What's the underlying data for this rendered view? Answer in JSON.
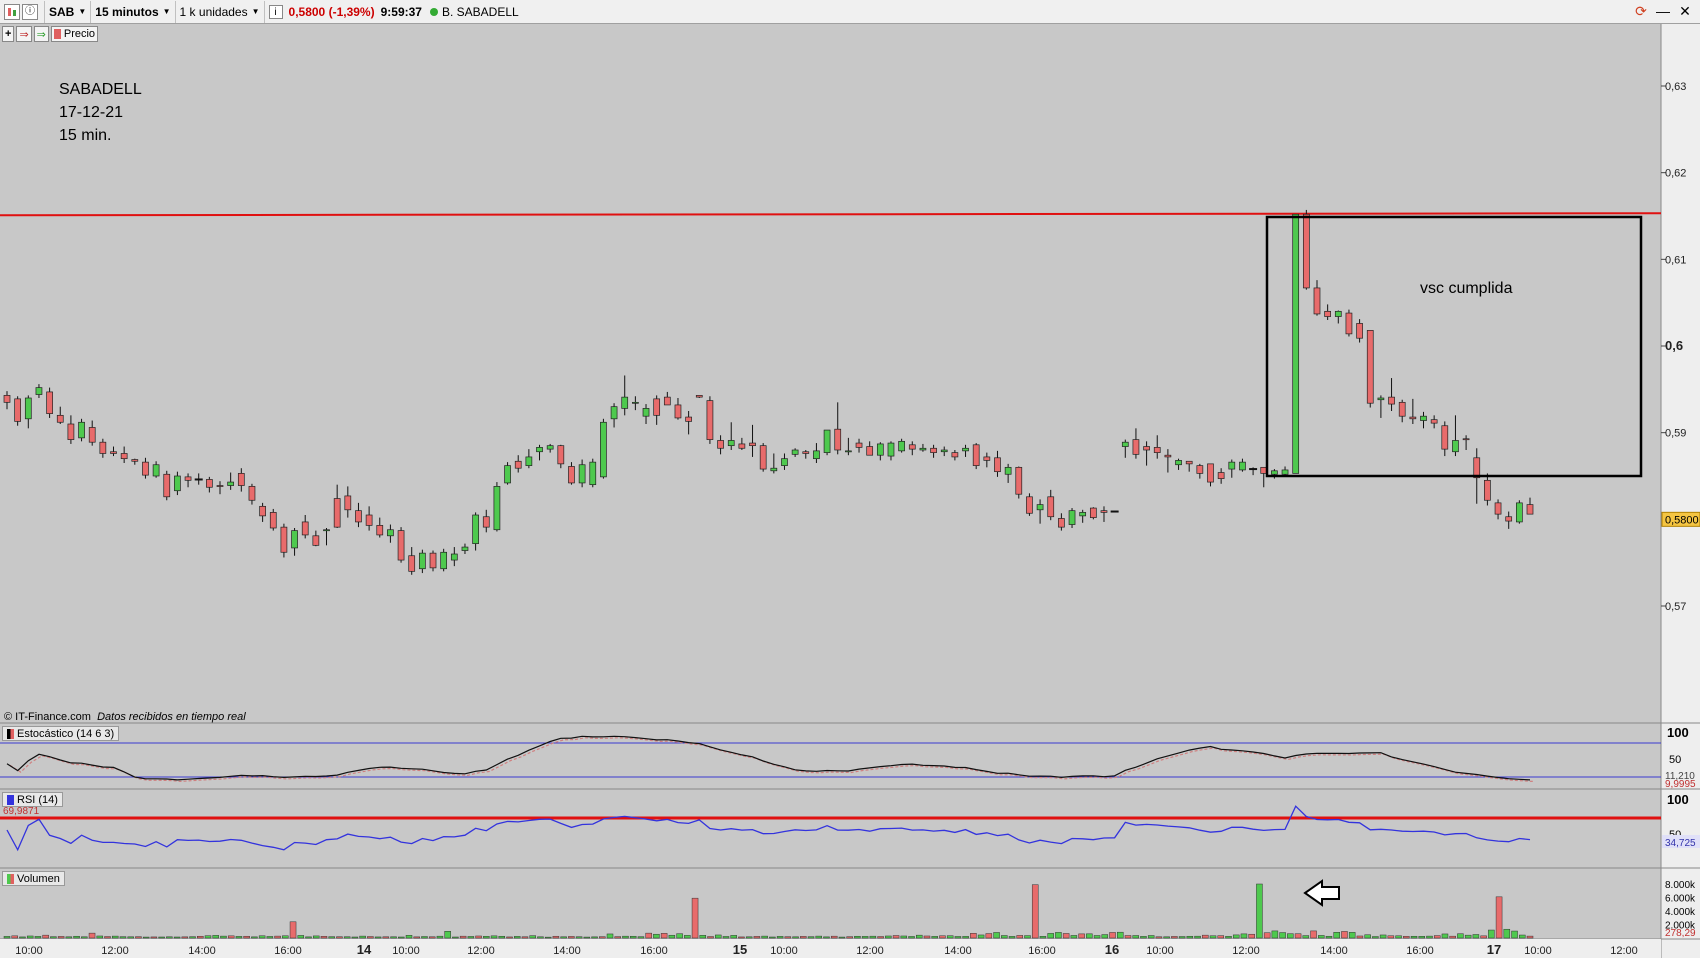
{
  "toolbar": {
    "symbol": "SAB",
    "interval": "15 minutos",
    "units": "1 k unidades",
    "price": "0,5800",
    "change": "(-1,39%)",
    "time": "9:59:37",
    "company": "B. SABADELL"
  },
  "subbar": {
    "price_label": "Precio"
  },
  "annotations": {
    "line1": "SABADELL",
    "line2": "17-12-21",
    "line3": "15 min.",
    "box_note": "vsc cumplida"
  },
  "credits": {
    "source": "© IT-Finance.com",
    "note": "Datos recibidos en tiempo real"
  },
  "indicators": {
    "stoch_label": "Estocástico (14 6 3)",
    "rsi_label": "RSI (14)",
    "vol_label": "Volumen",
    "rsi_line_value": "69,9871",
    "stoch_val1": "11,210",
    "stoch_val2": "9,9995",
    "rsi_current": "34,725",
    "vol_current": "278,29"
  },
  "colors": {
    "up": "#4ec94e",
    "down": "#e86b6b",
    "resistance": "#e01010",
    "stoch_band": "#3a3ad0",
    "rsi": "#3333dd"
  },
  "chart_data": {
    "type": "candlestick",
    "price_axis_ticks": [
      "0,63",
      "0,62",
      "0,61",
      "0,6",
      "0,59",
      "0,57"
    ],
    "current_price_label": "0,5800",
    "stoch_axis_ticks": [
      "100",
      "50"
    ],
    "rsi_axis_ticks": [
      "100",
      "50"
    ],
    "volume_axis_ticks": [
      "8.000k",
      "6.000k",
      "4.000k",
      "2.000k"
    ],
    "time_labels": [
      "10:00",
      "12:00",
      "14:00",
      "16:00",
      "14",
      "10:00",
      "12:00",
      "14:00",
      "16:00",
      "15",
      "10:00",
      "12:00",
      "14:00",
      "16:00",
      "16",
      "10:00",
      "12:00",
      "14:00",
      "16:00",
      "17",
      "10:00",
      "12:00"
    ],
    "resistance_level": 0.6152,
    "ylim": [
      0.564,
      0.635
    ],
    "candles": [
      [
        0.5943,
        0.5948,
        0.5927,
        0.5935
      ],
      [
        0.5939,
        0.5942,
        0.5908,
        0.5913
      ],
      [
        0.5916,
        0.5943,
        0.5905,
        0.594
      ],
      [
        0.5944,
        0.5956,
        0.594,
        0.5952
      ],
      [
        0.5947,
        0.5952,
        0.5917,
        0.5922
      ],
      [
        0.592,
        0.593,
        0.591,
        0.5912
      ],
      [
        0.591,
        0.592,
        0.5887,
        0.5892
      ],
      [
        0.5894,
        0.5916,
        0.589,
        0.5912
      ],
      [
        0.5906,
        0.5914,
        0.5885,
        0.5889
      ],
      [
        0.5889,
        0.5893,
        0.5871,
        0.5876
      ],
      [
        0.5878,
        0.5884,
        0.5873,
        0.5876
      ],
      [
        0.5876,
        0.5884,
        0.5865,
        0.587
      ],
      [
        0.5869,
        0.587,
        0.5863,
        0.5867
      ],
      [
        0.5866,
        0.5871,
        0.5847,
        0.5851
      ],
      [
        0.585,
        0.5867,
        0.5848,
        0.5863
      ],
      [
        0.5852,
        0.5856,
        0.5822,
        0.5826
      ],
      [
        0.5833,
        0.5855,
        0.5828,
        0.585
      ],
      [
        0.5849,
        0.5853,
        0.5837,
        0.5845
      ],
      [
        0.5846,
        0.5853,
        0.584,
        0.5846
      ],
      [
        0.5846,
        0.5849,
        0.5831,
        0.5837
      ],
      [
        0.5839,
        0.5844,
        0.5829,
        0.5838
      ],
      [
        0.5839,
        0.5854,
        0.5834,
        0.5843
      ],
      [
        0.5853,
        0.5859,
        0.5832,
        0.5839
      ],
      [
        0.5838,
        0.5841,
        0.5817,
        0.5822
      ],
      [
        0.5815,
        0.5819,
        0.5797,
        0.5804
      ],
      [
        0.5808,
        0.5812,
        0.5787,
        0.579
      ],
      [
        0.5791,
        0.5795,
        0.5756,
        0.5762
      ],
      [
        0.5767,
        0.579,
        0.5758,
        0.5787
      ],
      [
        0.5797,
        0.5805,
        0.5778,
        0.5782
      ],
      [
        0.5781,
        0.5787,
        0.5769,
        0.577
      ],
      [
        0.5787,
        0.579,
        0.577,
        0.5788
      ],
      [
        0.5824,
        0.584,
        0.579,
        0.5791
      ],
      [
        0.5827,
        0.5838,
        0.5802,
        0.5811
      ],
      [
        0.581,
        0.5819,
        0.5791,
        0.5797
      ],
      [
        0.5805,
        0.5815,
        0.5787,
        0.5793
      ],
      [
        0.5793,
        0.5802,
        0.5779,
        0.5782
      ],
      [
        0.5781,
        0.5794,
        0.5773,
        0.5788
      ],
      [
        0.5787,
        0.5791,
        0.575,
        0.5753
      ],
      [
        0.5758,
        0.5768,
        0.5736,
        0.574
      ],
      [
        0.5743,
        0.5765,
        0.5738,
        0.5761
      ],
      [
        0.5761,
        0.5764,
        0.574,
        0.5744
      ],
      [
        0.5743,
        0.5766,
        0.574,
        0.5762
      ],
      [
        0.5753,
        0.5768,
        0.5746,
        0.576
      ],
      [
        0.5764,
        0.5772,
        0.576,
        0.5768
      ],
      [
        0.5772,
        0.5808,
        0.5764,
        0.5805
      ],
      [
        0.5803,
        0.5811,
        0.5785,
        0.5791
      ],
      [
        0.5788,
        0.5843,
        0.5786,
        0.5838
      ],
      [
        0.5842,
        0.5866,
        0.584,
        0.5862
      ],
      [
        0.5867,
        0.5874,
        0.5854,
        0.5859
      ],
      [
        0.5862,
        0.5881,
        0.5859,
        0.5872
      ],
      [
        0.5878,
        0.5886,
        0.5868,
        0.5883
      ],
      [
        0.5881,
        0.5887,
        0.5877,
        0.5885
      ],
      [
        0.5885,
        0.5886,
        0.5859,
        0.5864
      ],
      [
        0.5861,
        0.5866,
        0.584,
        0.5842
      ],
      [
        0.5842,
        0.5869,
        0.5837,
        0.5863
      ],
      [
        0.584,
        0.587,
        0.5837,
        0.5866
      ],
      [
        0.5849,
        0.5916,
        0.5847,
        0.5912
      ],
      [
        0.5916,
        0.5934,
        0.5906,
        0.593
      ],
      [
        0.5928,
        0.5966,
        0.592,
        0.5941
      ],
      [
        0.5934,
        0.5942,
        0.5926,
        0.5935
      ],
      [
        0.5919,
        0.5933,
        0.591,
        0.5928
      ],
      [
        0.5939,
        0.5943,
        0.5909,
        0.592
      ],
      [
        0.5941,
        0.5947,
        0.5938,
        0.5932
      ],
      [
        0.5932,
        0.594,
        0.5915,
        0.5917
      ],
      [
        0.5918,
        0.5925,
        0.5898,
        0.5913
      ],
      [
        0.5943,
        0.5943,
        0.594,
        0.5941
      ],
      [
        0.5937,
        0.5942,
        0.5887,
        0.5892
      ],
      [
        0.5891,
        0.5897,
        0.5875,
        0.5882
      ],
      [
        0.5885,
        0.5912,
        0.588,
        0.5891
      ],
      [
        0.5887,
        0.5894,
        0.588,
        0.5882
      ],
      [
        0.5888,
        0.5909,
        0.5872,
        0.5885
      ],
      [
        0.5885,
        0.5888,
        0.5855,
        0.5858
      ],
      [
        0.5856,
        0.5876,
        0.5853,
        0.5859
      ],
      [
        0.5862,
        0.5876,
        0.5857,
        0.587
      ],
      [
        0.5875,
        0.5882,
        0.5872,
        0.588
      ],
      [
        0.5878,
        0.588,
        0.587,
        0.5876
      ],
      [
        0.587,
        0.5888,
        0.5865,
        0.5879
      ],
      [
        0.5877,
        0.5901,
        0.5874,
        0.5903
      ],
      [
        0.5904,
        0.5935,
        0.5875,
        0.588
      ],
      [
        0.5878,
        0.5894,
        0.5874,
        0.5879
      ],
      [
        0.5888,
        0.5893,
        0.5877,
        0.5883
      ],
      [
        0.5884,
        0.589,
        0.588,
        0.5874
      ],
      [
        0.5874,
        0.5889,
        0.5868,
        0.5887
      ],
      [
        0.5873,
        0.589,
        0.5868,
        0.5888
      ],
      [
        0.5879,
        0.5893,
        0.5877,
        0.589
      ],
      [
        0.5886,
        0.589,
        0.5874,
        0.5881
      ],
      [
        0.588,
        0.5887,
        0.5878,
        0.5882
      ],
      [
        0.5882,
        0.5886,
        0.5871,
        0.5877
      ],
      [
        0.5878,
        0.5884,
        0.5873,
        0.588
      ],
      [
        0.5877,
        0.588,
        0.5868,
        0.5872
      ],
      [
        0.5879,
        0.5886,
        0.5872,
        0.5882
      ],
      [
        0.5886,
        0.5888,
        0.5858,
        0.5862
      ],
      [
        0.5872,
        0.5877,
        0.586,
        0.5868
      ],
      [
        0.5871,
        0.5879,
        0.5849,
        0.5855
      ],
      [
        0.5852,
        0.5864,
        0.5842,
        0.586
      ],
      [
        0.586,
        0.5861,
        0.5824,
        0.5829
      ],
      [
        0.5826,
        0.583,
        0.5804,
        0.5807
      ],
      [
        0.5811,
        0.5823,
        0.5795,
        0.5817
      ],
      [
        0.5826,
        0.5834,
        0.5799,
        0.5803
      ],
      [
        0.5801,
        0.5807,
        0.5787,
        0.5791
      ],
      [
        0.5794,
        0.5813,
        0.579,
        0.581
      ],
      [
        0.5804,
        0.5811,
        0.5796,
        0.5808
      ],
      [
        0.5813,
        0.5814,
        0.58,
        0.5802
      ],
      [
        0.581,
        0.5815,
        0.5797,
        0.5808
      ],
      [
        0.5809,
        0.5809,
        0.5809,
        0.5809
      ],
      [
        0.5884,
        0.5892,
        0.5871,
        0.5889
      ],
      [
        0.5892,
        0.5905,
        0.587,
        0.5875
      ],
      [
        0.5884,
        0.589,
        0.5862,
        0.588
      ],
      [
        0.5883,
        0.5897,
        0.587,
        0.5877
      ],
      [
        0.5874,
        0.5881,
        0.5854,
        0.5872
      ],
      [
        0.5863,
        0.587,
        0.5857,
        0.5868
      ],
      [
        0.5867,
        0.5866,
        0.5855,
        0.5864
      ],
      [
        0.5862,
        0.5864,
        0.5847,
        0.5853
      ],
      [
        0.5864,
        0.5861,
        0.5838,
        0.5843
      ],
      [
        0.5854,
        0.5859,
        0.5841,
        0.5847
      ],
      [
        0.5858,
        0.5869,
        0.5848,
        0.5866
      ],
      [
        0.5857,
        0.587,
        0.5855,
        0.5866
      ],
      [
        0.5858,
        0.586,
        0.5851,
        0.5858
      ],
      [
        0.586,
        0.5859,
        0.5837,
        0.5853
      ],
      [
        0.5852,
        0.5858,
        0.5847,
        0.5856
      ],
      [
        0.5852,
        0.5861,
        0.5849,
        0.5857
      ],
      [
        0.5853,
        0.6152,
        0.5855,
        0.6152
      ],
      [
        0.6152,
        0.6157,
        0.6065,
        0.6067
      ],
      [
        0.6067,
        0.6076,
        0.6035,
        0.6037
      ],
      [
        0.604,
        0.6048,
        0.603,
        0.6034
      ],
      [
        0.6034,
        0.6041,
        0.6026,
        0.604
      ],
      [
        0.6038,
        0.6042,
        0.6011,
        0.6014
      ],
      [
        0.6026,
        0.6031,
        0.6004,
        0.6009
      ],
      [
        0.6018,
        0.6018,
        0.5929,
        0.5934
      ],
      [
        0.5938,
        0.5943,
        0.5917,
        0.594
      ],
      [
        0.5941,
        0.5963,
        0.5925,
        0.5933
      ],
      [
        0.5935,
        0.5938,
        0.5912,
        0.5919
      ],
      [
        0.5918,
        0.5939,
        0.591,
        0.5916
      ],
      [
        0.5914,
        0.5924,
        0.5905,
        0.5919
      ],
      [
        0.5915,
        0.592,
        0.5905,
        0.5911
      ],
      [
        0.5908,
        0.5913,
        0.5873,
        0.5881
      ],
      [
        0.5878,
        0.592,
        0.5873,
        0.5891
      ],
      [
        0.5893,
        0.5897,
        0.588,
        0.5892
      ],
      [
        0.5871,
        0.5882,
        0.5818,
        0.5848
      ],
      [
        0.5845,
        0.5853,
        0.5816,
        0.5822
      ],
      [
        0.5819,
        0.5823,
        0.58,
        0.5806
      ],
      [
        0.5803,
        0.5809,
        0.5789,
        0.5798
      ],
      [
        0.5797,
        0.5822,
        0.5795,
        0.5819
      ],
      [
        0.5817,
        0.5825,
        0.5809,
        0.5806
      ]
    ],
    "volumes_k": [
      240,
      320,
      160,
      300,
      240,
      420,
      200,
      230,
      180,
      260,
      180,
      720,
      300,
      220,
      280,
      200,
      180,
      200,
      140,
      160,
      150,
      180,
      150,
      170,
      200,
      260,
      340,
      390,
      280,
      320,
      240,
      260,
      170,
      330,
      230,
      280,
      330,
      2400,
      380,
      170,
      310,
      250,
      200,
      190,
      190,
      150,
      280,
      220,
      160,
      180,
      180,
      150,
      400,
      170,
      220,
      180,
      270,
      1000,
      150,
      270,
      230,
      300,
      250,
      320,
      260,
      160,
      240,
      180,
      350,
      180,
      130,
      260,
      180,
      230,
      190,
      140,
      170,
      200,
      600,
      210,
      270,
      260,
      200,
      720,
      560,
      690,
      410,
      640,
      390,
      5900,
      400,
      220,
      450,
      230,
      390,
      160,
      180,
      240,
      280,
      150,
      240,
      200,
      180,
      240,
      200,
      280,
      170,
      270,
      140,
      200,
      260,
      240,
      270,
      220,
      300,
      370,
      300,
      230,
      420,
      300,
      240,
      330,
      340,
      230,
      240,
      700,
      450,
      660,
      820,
      370,
      240,
      380,
      360,
      7900,
      250,
      680,
      830,
      670,
      380,
      610,
      620,
      370,
      510,
      820,
      860,
      370,
      370,
      240,
      370,
      180,
      180,
      230,
      220,
      260,
      270,
      420,
      330,
      350,
      250,
      460,
      610,
      560,
      8000,
      780,
      1050,
      810,
      640,
      630,
      360,
      1050,
      380,
      260,
      850,
      970,
      840,
      300,
      480,
      220,
      450,
      330,
      330,
      250,
      260,
      250,
      280,
      360,
      600,
      270,
      630,
      420,
      520,
      320,
      1180,
      6100,
      1300,
      1030,
      440,
      280
    ]
  }
}
